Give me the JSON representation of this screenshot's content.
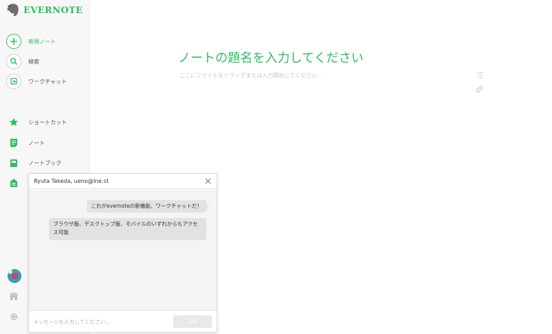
{
  "brand": {
    "name": "EVERNOTE",
    "accent": "#2dbe60"
  },
  "sidebar": {
    "actions": [
      {
        "label": "新規ノート",
        "icon": "plus-icon"
      },
      {
        "label": "検索",
        "icon": "search-icon"
      },
      {
        "label": "ワークチャット",
        "icon": "work-chat-icon"
      }
    ],
    "items": [
      {
        "label": "ショートカット",
        "icon": "star-icon"
      },
      {
        "label": "ノート",
        "icon": "note-icon"
      },
      {
        "label": "ノートブック",
        "icon": "notebook-icon"
      },
      {
        "label": "",
        "icon": "tag-icon"
      }
    ],
    "bottom": [
      {
        "icon": "avatar-icon"
      },
      {
        "icon": "market-icon"
      },
      {
        "icon": "settings-icon"
      }
    ]
  },
  "editor": {
    "title_placeholder": "ノートの題名を入力してください",
    "body_placeholder": "ここにファイルをドラッグまたは入力開始してください..."
  },
  "chat": {
    "title": "Ryuta Takeda, ueno@lne.st",
    "messages": [
      {
        "from": "me",
        "text": "これがevernoteの新機能、ワークチャットだ！"
      },
      {
        "from": "other",
        "text": "ブラウザ版、デスクトップ版、モバイルのいずれからもアクセス可能"
      }
    ],
    "input_placeholder": "メッセージを入力してください...",
    "send_label": "送信"
  }
}
